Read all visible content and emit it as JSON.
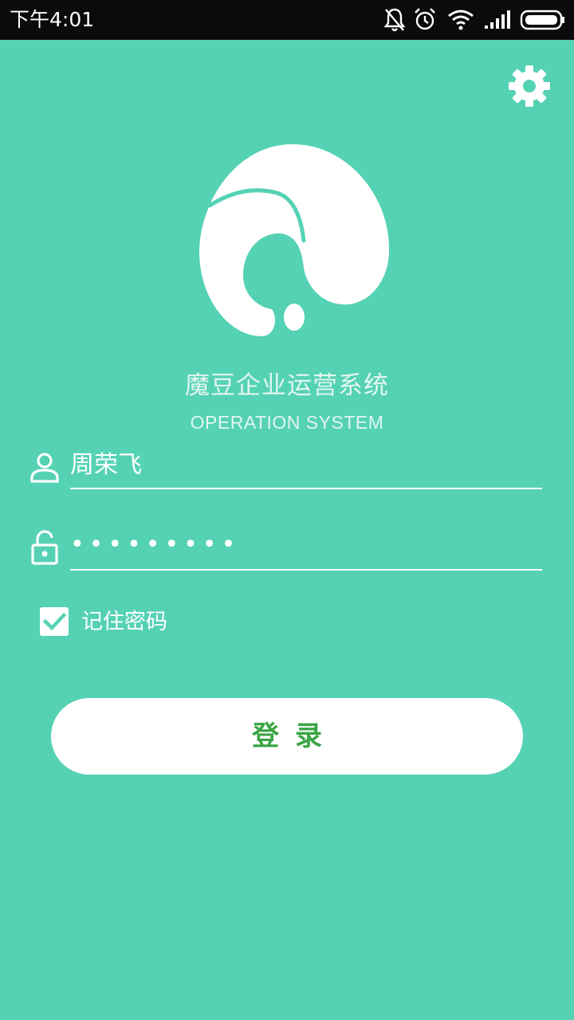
{
  "status_bar": {
    "time": "下午4:01",
    "icons": [
      "notifications-off-icon",
      "alarm-icon",
      "wifi-icon",
      "signal-icon",
      "battery-icon"
    ]
  },
  "header": {
    "settings_icon": "gear-icon"
  },
  "app": {
    "title": "魔豆企业运营系统",
    "subtitle": "OPERATION SYSTEM"
  },
  "form": {
    "username": {
      "icon": "user-icon",
      "value": "周荣飞"
    },
    "password": {
      "icon": "lock-icon",
      "masked_value": "•••••••••"
    },
    "remember": {
      "checked": true,
      "label": "记住密码"
    },
    "login_button": {
      "label": "登录"
    }
  },
  "colors": {
    "background": "#55d2b4",
    "status_bar": "#0b0b0b",
    "button_text": "#3aa544",
    "foreground": "#ffffff"
  }
}
